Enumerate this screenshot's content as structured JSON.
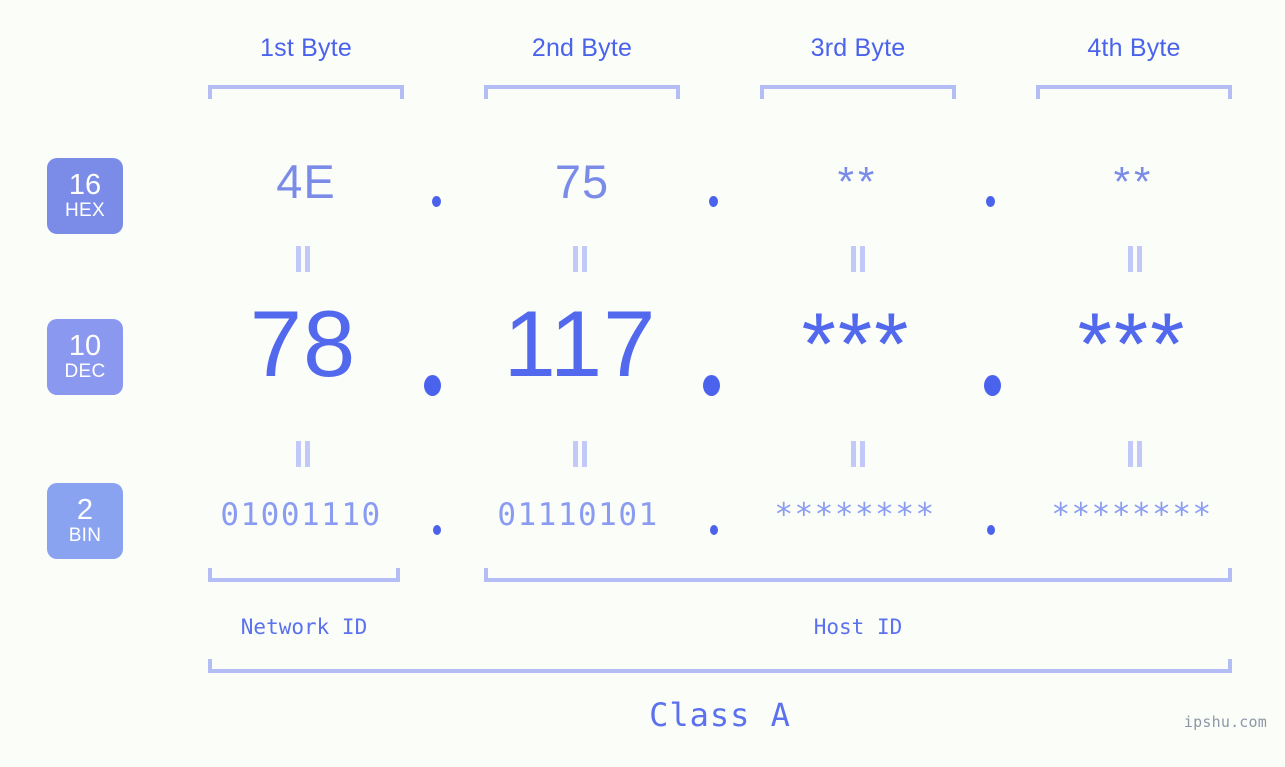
{
  "meta": {
    "background_color": "#fbfdf8",
    "accent_strong": "#4b63ec",
    "accent_mid": "#7b8ce8",
    "accent_light": "#b4bdf6",
    "watermark": "ipshu.com"
  },
  "byte_headings": [
    {
      "label": "1st Byte"
    },
    {
      "label": "2nd Byte"
    },
    {
      "label": "3rd Byte"
    },
    {
      "label": "4th Byte"
    }
  ],
  "rows": [
    {
      "key": "hex",
      "badge_number": "16",
      "badge_label": "HEX",
      "badge_color": "#7b8ce8",
      "values": [
        "4E",
        "75",
        "**",
        "**"
      ],
      "separators": [
        ".",
        ".",
        "."
      ]
    },
    {
      "key": "dec",
      "badge_number": "10",
      "badge_label": "DEC",
      "badge_color": "#8b98ef",
      "values": [
        "78",
        "117",
        "***",
        "***"
      ],
      "separators": [
        ".",
        ".",
        "."
      ]
    },
    {
      "key": "bin",
      "badge_number": "2",
      "badge_label": "BIN",
      "badge_color": "#8aa3f0",
      "values": [
        "01001110",
        "01110101",
        "********",
        "********"
      ],
      "separators": [
        ".",
        ".",
        "."
      ]
    }
  ],
  "equals_connectors": {
    "glyph": "=",
    "count_per_gap": 4
  },
  "id_sections": [
    {
      "label": "Network ID"
    },
    {
      "label": "Host ID"
    }
  ],
  "class_section": {
    "label": "Class A"
  }
}
